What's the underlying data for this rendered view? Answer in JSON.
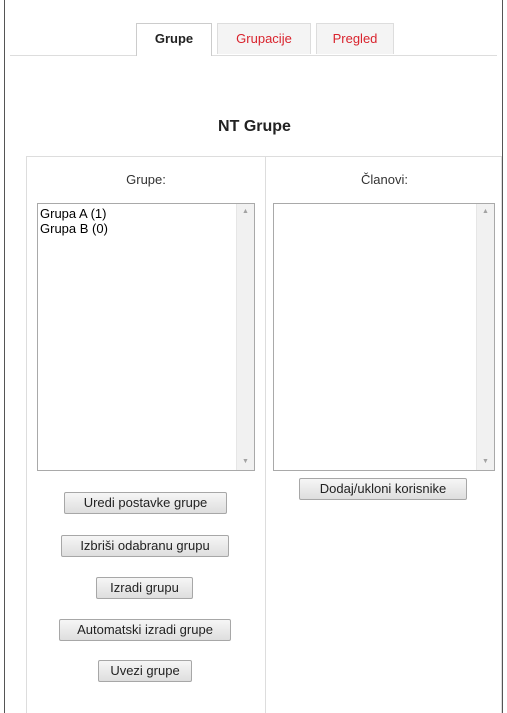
{
  "tabs": [
    {
      "label": "Grupe",
      "active": true
    },
    {
      "label": "Grupacije",
      "active": false
    },
    {
      "label": "Pregled",
      "active": false
    }
  ],
  "page_title": "NT Grupe",
  "groups_panel": {
    "label": "Grupe:",
    "items": [
      "Grupa A (1)",
      "Grupa B (0)"
    ],
    "buttons": {
      "edit": "Uredi postavke grupe",
      "delete": "Izbriši odabranu grupu",
      "create": "Izradi grupu",
      "auto_create": "Automatski izradi grupe",
      "import": "Uvezi grupe"
    }
  },
  "members_panel": {
    "label": "Članovi:",
    "items": [],
    "buttons": {
      "add_remove": "Dodaj/ukloni korisnike"
    }
  },
  "colors": {
    "tab_text": "#d9232d",
    "active_tab_text": "#222222",
    "border": "#dddddd"
  }
}
